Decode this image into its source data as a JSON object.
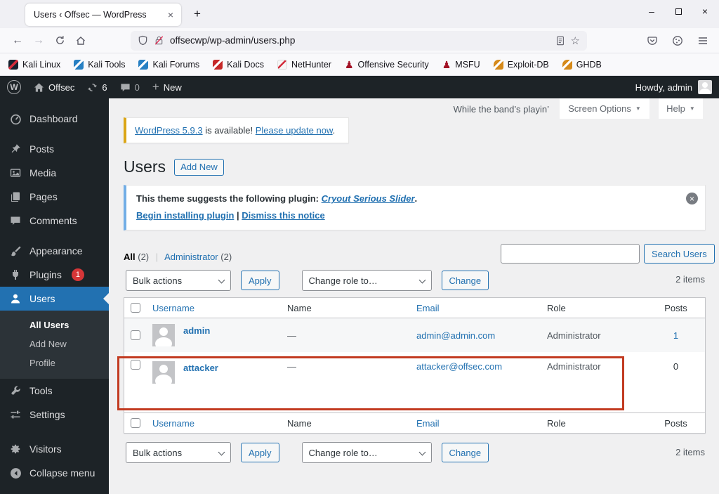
{
  "browser": {
    "tab_title": "Users ‹ Offsec — WordPress",
    "url": "offsecwp/wp-admin/users.php",
    "glyphs": {
      "close": "×",
      "plus": "+",
      "minus": "–",
      "back": "←",
      "forward": "→",
      "star": "☆",
      "caret": "▼",
      "pawn": "♟"
    },
    "bookmarks": [
      {
        "label": "Kali Linux"
      },
      {
        "label": "Kali Tools"
      },
      {
        "label": "Kali Forums"
      },
      {
        "label": "Kali Docs"
      },
      {
        "label": "NetHunter"
      },
      {
        "label": "Offensive Security"
      },
      {
        "label": "MSFU"
      },
      {
        "label": "Exploit-DB"
      },
      {
        "label": "GHDB"
      }
    ]
  },
  "admin_bar": {
    "wp_logo": "W",
    "site_name": "Offsec",
    "update_count": "6",
    "comment_count": "0",
    "new_label": "New",
    "howdy": "Howdy, admin"
  },
  "sidebar": {
    "items": [
      {
        "label": "Dashboard"
      },
      {
        "label": "Posts"
      },
      {
        "label": "Media"
      },
      {
        "label": "Pages"
      },
      {
        "label": "Comments"
      },
      {
        "label": "Appearance"
      },
      {
        "label": "Plugins",
        "badge": "1"
      },
      {
        "label": "Users"
      },
      {
        "label": "Tools"
      },
      {
        "label": "Settings"
      },
      {
        "label": "Visitors"
      },
      {
        "label": "Collapse menu"
      }
    ],
    "users_submenu": [
      {
        "label": "All Users"
      },
      {
        "label": "Add New"
      },
      {
        "label": "Profile"
      }
    ]
  },
  "page": {
    "quote": "While the band’s playin’",
    "screen_options_label": "Screen Options",
    "help_label": "Help",
    "update_notice": {
      "link1": "WordPress 5.9.3",
      "middle": " is available! ",
      "link2": "Please update now",
      "end": "."
    },
    "title": "Users",
    "add_new_label": "Add New",
    "theme_notice": {
      "text": "This theme suggests the following plugin: ",
      "plugin_link": "Cryout Serious Slider",
      "period": ".",
      "install_link": "Begin installing plugin",
      "separator": " | ",
      "dismiss_link": "Dismiss this notice"
    },
    "views": {
      "all_label": "All",
      "all_count": "(2)",
      "pipe": "|",
      "admin_label": "Administrator",
      "admin_count": "(2)"
    },
    "bulk_actions_label": "Bulk actions",
    "apply_label": "Apply",
    "change_role_label": "Change role to…",
    "change_label": "Change",
    "search_button": "Search Users",
    "items_count": "2 items"
  },
  "table": {
    "headers": {
      "username": "Username",
      "name": "Name",
      "email": "Email",
      "role": "Role",
      "posts": "Posts"
    },
    "rows": [
      {
        "username": "admin",
        "name": "—",
        "email": "admin@admin.com",
        "role": "Administrator",
        "posts": "1"
      },
      {
        "username": "attacker",
        "name": "—",
        "email": "attacker@offsec.com",
        "role": "Administrator",
        "posts": "0"
      }
    ]
  },
  "annotation": {
    "highlight_color": "#c23b21",
    "highlight_target": "attacker-row"
  }
}
